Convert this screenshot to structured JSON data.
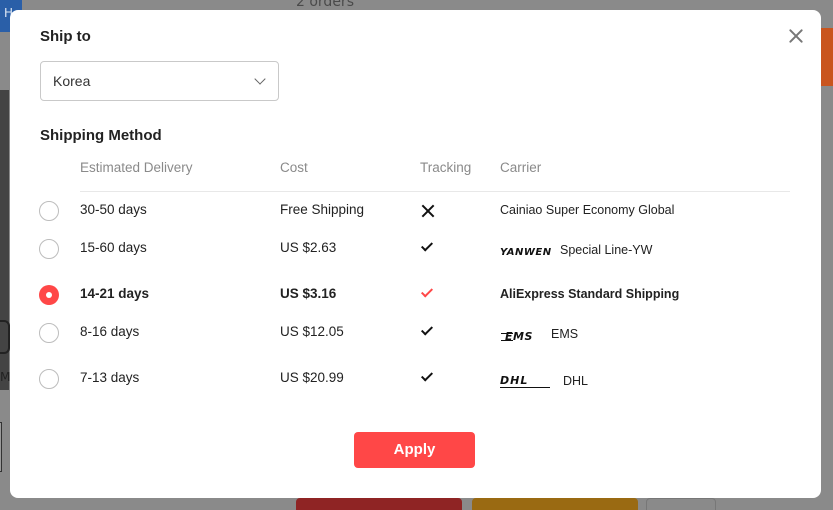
{
  "background": {
    "orders_text": "2 orders",
    "tab_letter": "H",
    "side_letter": "M"
  },
  "modal": {
    "ship_to_label": "Ship to",
    "country_value": "Korea",
    "shipping_method_label": "Shipping Method",
    "apply_label": "Apply",
    "columns": {
      "delivery": "Estimated Delivery",
      "cost": "Cost",
      "tracking": "Tracking",
      "carrier": "Carrier"
    },
    "rows": [
      {
        "delivery": "30-50 days",
        "cost": "Free Shipping",
        "tracking": false,
        "carrier": "Cainiao Super Economy Global",
        "carrier_logo": "",
        "selected": false
      },
      {
        "delivery": "15-60 days",
        "cost": "US $2.63",
        "tracking": true,
        "carrier": "Special Line-YW",
        "carrier_logo": "YANWEN",
        "selected": false
      },
      {
        "delivery": "14-21 days",
        "cost": "US $3.16",
        "tracking": true,
        "carrier": "AliExpress Standard Shipping",
        "carrier_logo": "",
        "selected": true
      },
      {
        "delivery": "8-16 days",
        "cost": "US $12.05",
        "tracking": true,
        "carrier": "EMS",
        "carrier_logo": "EMS",
        "selected": false
      },
      {
        "delivery": "7-13 days",
        "cost": "US $20.99",
        "tracking": true,
        "carrier": "DHL",
        "carrier_logo": "DHL",
        "selected": false
      }
    ]
  },
  "colors": {
    "accent": "#ff4747",
    "overlay": "#8a8a8a"
  },
  "icons": [
    "close-icon",
    "chevron-down-icon",
    "cross-icon",
    "check-icon"
  ]
}
